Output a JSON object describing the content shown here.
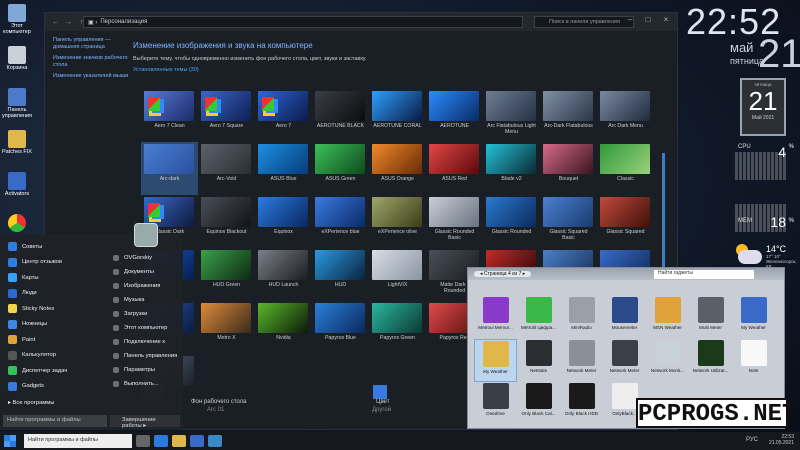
{
  "desktop": {
    "icons": [
      "Этот компьютер",
      "Корзина",
      "Панель управления",
      "Patches FIX",
      "Activators",
      ""
    ]
  },
  "window": {
    "breadcrumb": "Персонализация",
    "search_placeholder": "Поиск в панели управления",
    "nav": [
      "Панель управления — домашняя страница",
      "Изменение значков рабочего стола",
      "Изменение указателей мыши"
    ],
    "heading": "Изменение изображения и звука на компьютере",
    "description": "Выберите тему, чтобы одновременно изменить фон рабочего стола, цвет, звуки и заставку.",
    "section": "Установленные темы (30)",
    "themes": [
      {
        "label": "Aero 7 Clean",
        "c1": "#5b7bd8",
        "c2": "#1b2a6a",
        "icon": true
      },
      {
        "label": "Aero 7 Square",
        "c1": "#3d66c9",
        "c2": "#0d1f55",
        "icon": true
      },
      {
        "label": "Aero 7",
        "c1": "#2f66d6",
        "c2": "#0a1b4d",
        "icon": true
      },
      {
        "label": "AEROTUNE BLACK",
        "c1": "#3a3f46",
        "c2": "#0b0c0e",
        "icon": false
      },
      {
        "label": "AEROTUNE CORAL",
        "c1": "#2ea0ff",
        "c2": "#0a1a44",
        "icon": false
      },
      {
        "label": "AEROTUNE",
        "c1": "#2a8cff",
        "c2": "#0a2a66",
        "icon": false
      },
      {
        "label": "Arc Flatabulous Light Menu",
        "c1": "#6f7e94",
        "c2": "#243043",
        "icon": false
      },
      {
        "label": "Arc-Dark Flatabulous",
        "c1": "#8190a6",
        "c2": "#2a3548",
        "icon": false
      },
      {
        "label": "Arc Dark Menu",
        "c1": "#7b8aa2",
        "c2": "#1f2a3c",
        "icon": false
      },
      {
        "label": "Arc-dark",
        "c1": "#4a7fcf",
        "c2": "#2a4fa0",
        "icon": false
      },
      {
        "label": "Arc-Void",
        "c1": "#5d636b",
        "c2": "#2a2e33",
        "icon": false
      },
      {
        "label": "ASUS Blue",
        "c1": "#1d8fe0",
        "c2": "#063b7a",
        "icon": false
      },
      {
        "label": "ASUS Green",
        "c1": "#3cc05a",
        "c2": "#0e4a1c",
        "icon": false
      },
      {
        "label": "ASUS Orange",
        "c1": "#f08a2a",
        "c2": "#6a2a06",
        "icon": false
      },
      {
        "label": "ASUS Red",
        "c1": "#e24545",
        "c2": "#5a0a0a",
        "icon": false
      },
      {
        "label": "Blade v2",
        "c1": "#22c2d8",
        "c2": "#0a2a33",
        "icon": false
      },
      {
        "label": "Bouquet",
        "c1": "#d76a8a",
        "c2": "#3a1420",
        "icon": false
      },
      {
        "label": "Classic",
        "c1": "#2f9a3a",
        "c2": "#9ad07a",
        "icon": false
      },
      {
        "label": "Classic Dark",
        "c1": "#3d68c4",
        "c2": "#0c1a40",
        "icon": true
      },
      {
        "label": "Equinox Blackout",
        "c1": "#4a4f57",
        "c2": "#111317",
        "icon": false
      },
      {
        "label": "Equinox",
        "c1": "#2a7de0",
        "c2": "#0a2660",
        "icon": false
      },
      {
        "label": "eXPerience blue",
        "c1": "#3a7ae0",
        "c2": "#0a2a6a",
        "icon": false
      },
      {
        "label": "eXPerience olive",
        "c1": "#a0a66a",
        "c2": "#3a3d18",
        "icon": false
      },
      {
        "label": "Glassic Rounded Basic",
        "c1": "#c8ced6",
        "c2": "#6a7280",
        "icon": false
      },
      {
        "label": "Glassic Rounded",
        "c1": "#2a7ad0",
        "c2": "#0b2a5a",
        "icon": false
      },
      {
        "label": "Glassic Squared Basic",
        "c1": "#4a80d0",
        "c2": "#1a3a70",
        "icon": false
      },
      {
        "label": "Glassic Squared",
        "c1": "#c04a3a",
        "c2": "#401008",
        "icon": false
      },
      {
        "label": "",
        "c1": "#1a5ad0",
        "c2": "#061e50",
        "icon": false
      },
      {
        "label": "HUD Green",
        "c1": "#3aa04a",
        "c2": "#0c2a10",
        "icon": false
      },
      {
        "label": "HUD Launch",
        "c1": "#7a8088",
        "c2": "#1a1c20",
        "icon": false
      },
      {
        "label": "HUD",
        "c1": "#2a9ae0",
        "c2": "#0a2240",
        "icon": false
      },
      {
        "label": "LightVIX",
        "c1": "#d8dde4",
        "c2": "#8a94a2",
        "icon": false
      },
      {
        "label": "Matte Dark - Rounded",
        "c1": "#4a5058",
        "c2": "#1a1d22",
        "icon": false
      },
      {
        "label": "",
        "c1": "#c42a2a",
        "c2": "#2a0808",
        "icon": false
      },
      {
        "label": "",
        "c1": "#4a80c8",
        "c2": "#18305a",
        "icon": false
      },
      {
        "label": "",
        "c1": "#3a6ac8",
        "c2": "#0e2a5a",
        "icon": false
      },
      {
        "label": "",
        "c1": "#2a5ab0",
        "c2": "#0a1a40",
        "icon": false
      },
      {
        "label": "Metro X",
        "c1": "#e08a3a",
        "c2": "#3a2a1a",
        "icon": false
      },
      {
        "label": "Nvidia",
        "c1": "#5ab82a",
        "c2": "#0a1a06",
        "icon": false
      },
      {
        "label": "Papyros Blue",
        "c1": "#2a80d8",
        "c2": "#0a2860",
        "icon": false
      },
      {
        "label": "Papyros Green",
        "c1": "#2ab8a0",
        "c2": "#0a3a30",
        "icon": false
      },
      {
        "label": "Papyros Red",
        "c1": "#e04a4a",
        "c2": "#5a1010",
        "icon": false
      },
      {
        "label": "",
        "c1": "#2a6ad0",
        "c2": "#0a2050",
        "icon": false
      },
      {
        "label": "",
        "c1": "#4a7ac8",
        "c2": "#1a3060",
        "icon": false
      },
      {
        "label": "",
        "c1": "#3a70c0",
        "c2": "#102a58",
        "icon": false
      },
      {
        "label": "",
        "c1": "#5a6878",
        "c2": "#1a2028",
        "icon": false
      }
    ],
    "bottom": {
      "wallpaper": "Фон рабочего стола",
      "wallpaper_sub": "Arc 01",
      "color": "Цвет",
      "color_sub": "Другой"
    }
  },
  "clock": {
    "time": "22:52",
    "month": "май",
    "day": "21",
    "weekday": "пятница"
  },
  "gadgets": {
    "cal_top": "пятница",
    "cal_day": "21",
    "cal_bottom": "Май 2021",
    "cpu_label": "CPU",
    "cpu_val": "4",
    "cpu_unit": "%",
    "mem_label": "МЕМ",
    "mem_val": "18",
    "mem_unit": "%",
    "temp": "14°C",
    "temp_range": "17° 10°\nЖелезногорск, КР"
  },
  "start_menu": {
    "left": [
      {
        "label": "Советы",
        "color": "#2f7de0"
      },
      {
        "label": "Центр отзывов",
        "color": "#2f7de0"
      },
      {
        "label": "Карты",
        "color": "#3aa0ff"
      },
      {
        "label": "Люди",
        "color": "#2a6ad0"
      },
      {
        "label": "Sticky Notes",
        "color": "#f3d34a"
      },
      {
        "label": "Ножницы",
        "color": "#3a8ae0"
      },
      {
        "label": "Paint",
        "color": "#e0a23a"
      },
      {
        "label": "Калькулятор",
        "color": "#555"
      },
      {
        "label": "Диспетчер задач",
        "color": "#3ac05a"
      },
      {
        "label": "Gadgets",
        "color": "#3a7ae0"
      }
    ],
    "right": [
      "OVGorskiy",
      "Документы",
      "Изображения",
      "Музыка",
      "Загрузки",
      "Этот компьютер",
      "Подключение к",
      "Панель управления",
      "Параметры",
      "Выполнить..."
    ],
    "all_programs": "Все программы",
    "search": "Найти программы и файлы",
    "shutdown": "Завершение работы"
  },
  "gallery": {
    "page": "Страница 4 из 7",
    "search": "Найти гаджеты",
    "items": [
      {
        "label": "Metroui Memor...",
        "color": "#8a3ac8"
      },
      {
        "label": "Metrotil Цифра...",
        "color": "#3ab84a"
      },
      {
        "label": "MiniRadio",
        "color": "#9aa0a8"
      },
      {
        "label": "Mousemeter",
        "color": "#2a4a8a"
      },
      {
        "label": "MSN Weather",
        "color": "#e0a23a"
      },
      {
        "label": "Multi Meter",
        "color": "#5a6068"
      },
      {
        "label": "My Weather",
        "color": "#3a6ac8"
      },
      {
        "label": "My Weather",
        "color": "#e0b84a"
      },
      {
        "label": "Netstats",
        "color": "#2a2e33"
      },
      {
        "label": "Network Meter",
        "color": "#8a8f98"
      },
      {
        "label": "Network Meter",
        "color": "#3a4048"
      },
      {
        "label": "Network Monit...",
        "color": "#c8d0d8"
      },
      {
        "label": "Network Utilizat...",
        "color": "#1a3a1a"
      },
      {
        "label": "Note",
        "color": "#f8f8f8"
      },
      {
        "label": "Onedrive",
        "color": "#3a3e46"
      },
      {
        "label": "Only Black Cal...",
        "color": "#1a1a1a"
      },
      {
        "label": "Only Black HDD",
        "color": "#1a1a1a"
      },
      {
        "label": "OnlyBlack...",
        "color": "#eee"
      }
    ]
  },
  "watermark": "PCPROGS.NET",
  "taskbar": {
    "search": "Найти программы и файлы",
    "lang": "РУС",
    "time": "22:53",
    "date": "21.05.2021"
  }
}
